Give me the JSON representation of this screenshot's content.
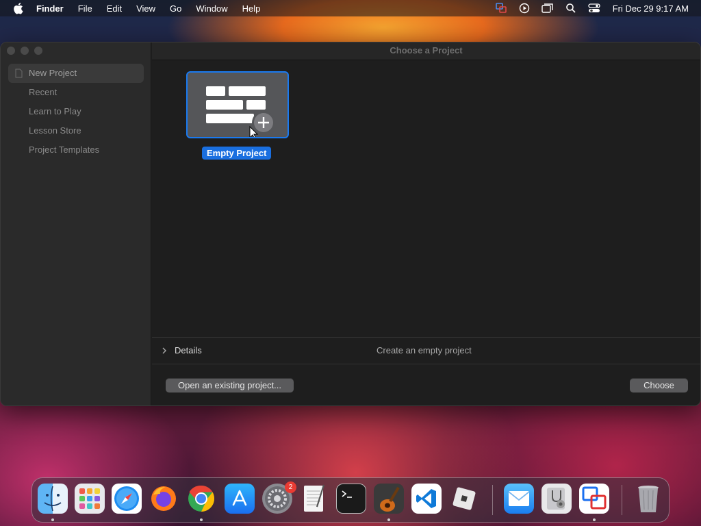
{
  "menubar": {
    "app_name": "Finder",
    "menus": [
      "File",
      "Edit",
      "View",
      "Go",
      "Window",
      "Help"
    ],
    "clock": "Fri Dec 29  9:17 AM"
  },
  "window": {
    "title": "Choose a Project",
    "sidebar": {
      "items": [
        {
          "label": "New Project",
          "selected": true
        },
        {
          "label": "Recent"
        },
        {
          "label": "Learn to Play"
        },
        {
          "label": "Lesson Store"
        },
        {
          "label": "Project Templates"
        }
      ]
    },
    "tile": {
      "label": "Empty Project",
      "selected": true
    },
    "details": {
      "label": "Details",
      "description": "Create an empty project"
    },
    "buttons": {
      "open_existing": "Open an existing project...",
      "choose": "Choose"
    }
  },
  "dock": {
    "apps": [
      {
        "name": "finder-icon",
        "running": true
      },
      {
        "name": "launchpad-icon"
      },
      {
        "name": "safari-icon"
      },
      {
        "name": "firefox-icon"
      },
      {
        "name": "chrome-icon",
        "running": true
      },
      {
        "name": "app-store-icon"
      },
      {
        "name": "system-settings-icon",
        "badge": "2"
      },
      {
        "name": "textedit-icon"
      },
      {
        "name": "terminal-icon"
      },
      {
        "name": "garageband-icon",
        "running": true
      },
      {
        "name": "vscode-icon"
      },
      {
        "name": "roblox-icon"
      },
      {
        "name": "mail-icon"
      },
      {
        "name": "disk-utility-icon"
      },
      {
        "name": "remote-desktop-icon",
        "running": true
      },
      {
        "name": "trash-icon"
      }
    ]
  },
  "colors": {
    "accent": "#1a6fe0",
    "window_bg": "#1e1e1e",
    "sidebar_bg": "#2a2a2a"
  }
}
